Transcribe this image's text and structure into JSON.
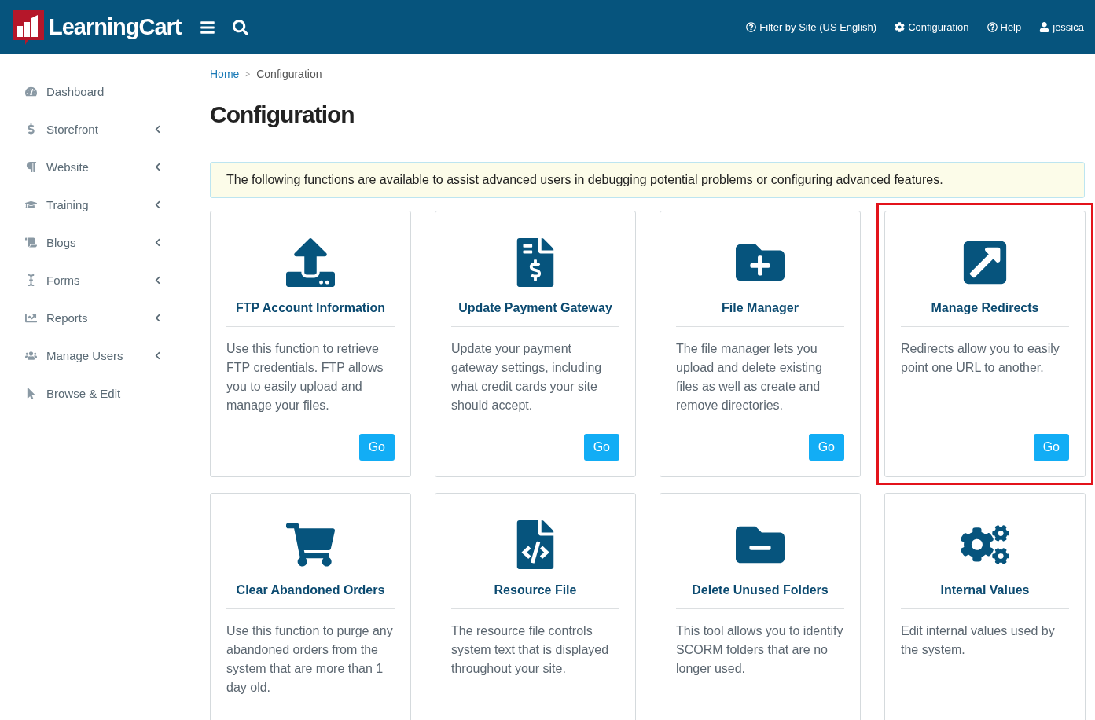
{
  "header": {
    "logo": "LearningCart",
    "links": [
      {
        "label": "Filter by Site (US English)"
      },
      {
        "label": "Configuration"
      },
      {
        "label": "Help"
      },
      {
        "label": "jessica"
      }
    ]
  },
  "sidebar": {
    "items": [
      {
        "label": "Dashboard",
        "expandable": false
      },
      {
        "label": "Storefront",
        "expandable": true
      },
      {
        "label": "Website",
        "expandable": true
      },
      {
        "label": "Training",
        "expandable": true
      },
      {
        "label": "Blogs",
        "expandable": true
      },
      {
        "label": "Forms",
        "expandable": true
      },
      {
        "label": "Reports",
        "expandable": true
      },
      {
        "label": "Manage Users",
        "expandable": true
      },
      {
        "label": "Browse & Edit",
        "expandable": false
      }
    ]
  },
  "breadcrumb": {
    "separator": ">",
    "items": [
      {
        "label": "Home",
        "link": true
      },
      {
        "label": "Configuration",
        "link": false
      }
    ]
  },
  "title": "Configuration",
  "notice": "The following functions are available to assist advanced users in debugging potential problems or configuring advanced features.",
  "cards": [
    {
      "title": "FTP Account Information",
      "text": "Use this function to retrieve FTP credentials. FTP allows you to easily upload and manage your files.",
      "button": "Go",
      "highlighted": false
    },
    {
      "title": "Update Payment Gateway",
      "text": "Update your payment gateway settings, including what credit cards your site should accept.",
      "button": "Go",
      "highlighted": false
    },
    {
      "title": "File Manager",
      "text": "The file manager lets you upload and delete existing files as well as create and remove directories.",
      "button": "Go",
      "highlighted": false
    },
    {
      "title": "Manage Redirects",
      "text": "Redirects allow you to easily point one URL to another.",
      "button": "Go",
      "highlighted": true
    },
    {
      "title": "Clear Abandoned Orders",
      "text": "Use this function to purge any abandoned orders from the system that are more than 1 day old.",
      "highlighted": false
    },
    {
      "title": "Resource File",
      "text": "The resource file controls system text that is displayed throughout your site.",
      "highlighted": false
    },
    {
      "title": "Delete Unused Folders",
      "text": "This tool allows you to identify SCORM folders that are no longer used.",
      "highlighted": false
    },
    {
      "title": "Internal Values",
      "text": "Edit internal values used by the system.",
      "highlighted": false
    }
  ]
}
